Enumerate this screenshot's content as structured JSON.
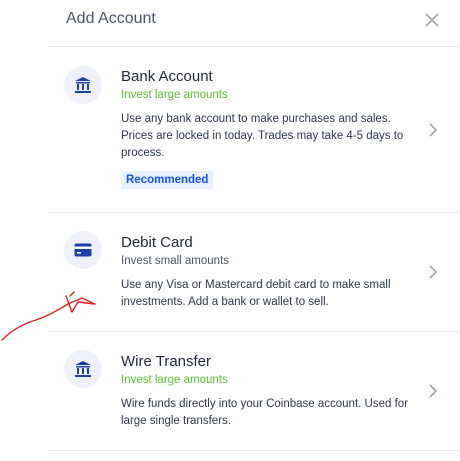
{
  "header": {
    "title": "Add Account"
  },
  "options": [
    {
      "title": "Bank Account",
      "subtitle": "Invest large amounts",
      "description": "Use any bank account to make purchases and sales. Prices are locked in today. Trades may take 4-5 days to process.",
      "badge": "Recommended",
      "icon": "bank-icon"
    },
    {
      "title": "Debit Card",
      "subtitle": "Invest small amounts",
      "description": "Use any Visa or Mastercard debit card to make small investments. Add a bank or wallet to sell.",
      "icon": "card-icon"
    },
    {
      "title": "Wire Transfer",
      "subtitle": "Invest large amounts",
      "description": "Wire funds directly into your Coinbase account. Used for large single transfers.",
      "icon": "bank-icon"
    }
  ],
  "colors": {
    "accent": "#1652f0",
    "green": "#5bbf32",
    "annotation": "#e02020"
  }
}
